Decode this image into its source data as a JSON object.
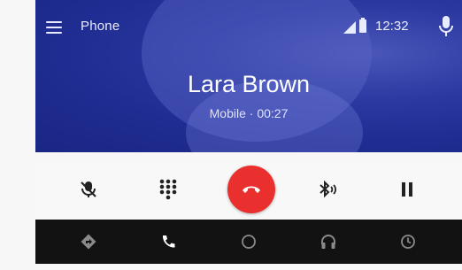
{
  "status_bar": {
    "app_title": "Phone",
    "time": "12:32",
    "icons": [
      "menu-icon",
      "signal-icon",
      "battery-icon",
      "mic-icon"
    ]
  },
  "call": {
    "caller_name": "Lara Brown",
    "call_info": "Mobile · 00:27"
  },
  "controls": [
    {
      "name": "mute-button",
      "icon": "mic-off-icon"
    },
    {
      "name": "dialpad-button",
      "icon": "dialpad-icon"
    },
    {
      "name": "end-call-button",
      "icon": "phone-hangup-icon"
    },
    {
      "name": "bluetooth-audio-button",
      "icon": "bluetooth-audio-icon"
    },
    {
      "name": "hold-button",
      "icon": "pause-icon"
    }
  ],
  "nav": [
    {
      "name": "nav-navigation",
      "icon": "directions-icon",
      "active": false
    },
    {
      "name": "nav-phone",
      "icon": "phone-icon",
      "active": true
    },
    {
      "name": "nav-home",
      "icon": "home-circle-icon",
      "active": false
    },
    {
      "name": "nav-media",
      "icon": "headphones-icon",
      "active": false
    },
    {
      "name": "nav-overview",
      "icon": "overview-icon",
      "active": false
    }
  ],
  "colors": {
    "header_bg": "#1f2c91",
    "end_call": "#ea2f2f",
    "nav_bg": "#121212",
    "nav_active": "#ffffff",
    "nav_inactive": "#8a8a8a"
  }
}
